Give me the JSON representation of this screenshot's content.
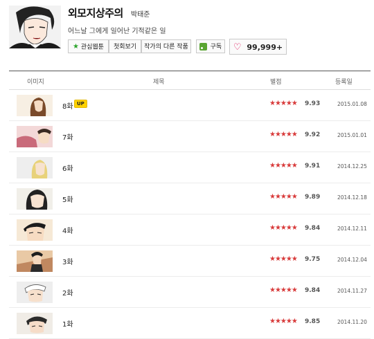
{
  "comic": {
    "title": "외모지상주의",
    "author": "박태준",
    "synopsis": "어느날 그에게 일어난 기적같은 일"
  },
  "actions": {
    "interest_label": "관심웹툰",
    "first_label": "첫회보기",
    "other_works_label": "작가의 다른 작품",
    "subscribe_label": "구독",
    "like_count": "99,999+"
  },
  "table": {
    "headers": {
      "image": "이미지",
      "title": "제목",
      "rating": "별점",
      "date": "등록일"
    },
    "rows": [
      {
        "title": "8화",
        "badge": "UP",
        "score": "9.93",
        "date": "2015.01.08"
      },
      {
        "title": "7화",
        "badge": "",
        "score": "9.92",
        "date": "2015.01.01"
      },
      {
        "title": "6화",
        "badge": "",
        "score": "9.91",
        "date": "2014.12.25"
      },
      {
        "title": "5화",
        "badge": "",
        "score": "9.89",
        "date": "2014.12.18"
      },
      {
        "title": "4화",
        "badge": "",
        "score": "9.84",
        "date": "2014.12.11"
      },
      {
        "title": "3화",
        "badge": "",
        "score": "9.75",
        "date": "2014.12.04"
      },
      {
        "title": "2화",
        "badge": "",
        "score": "9.84",
        "date": "2014.11.27"
      },
      {
        "title": "1화",
        "badge": "",
        "score": "9.85",
        "date": "2014.11.20"
      }
    ],
    "stars_text": "★★★★★"
  },
  "colors": {
    "accent_green": "#2ca52c",
    "star_red": "#d83a3a",
    "heart_pink": "#e0004d",
    "up_badge": "#ffd200"
  },
  "icons": {
    "interest": "star-icon",
    "subscribe": "rss-icon",
    "like": "heart-icon"
  }
}
